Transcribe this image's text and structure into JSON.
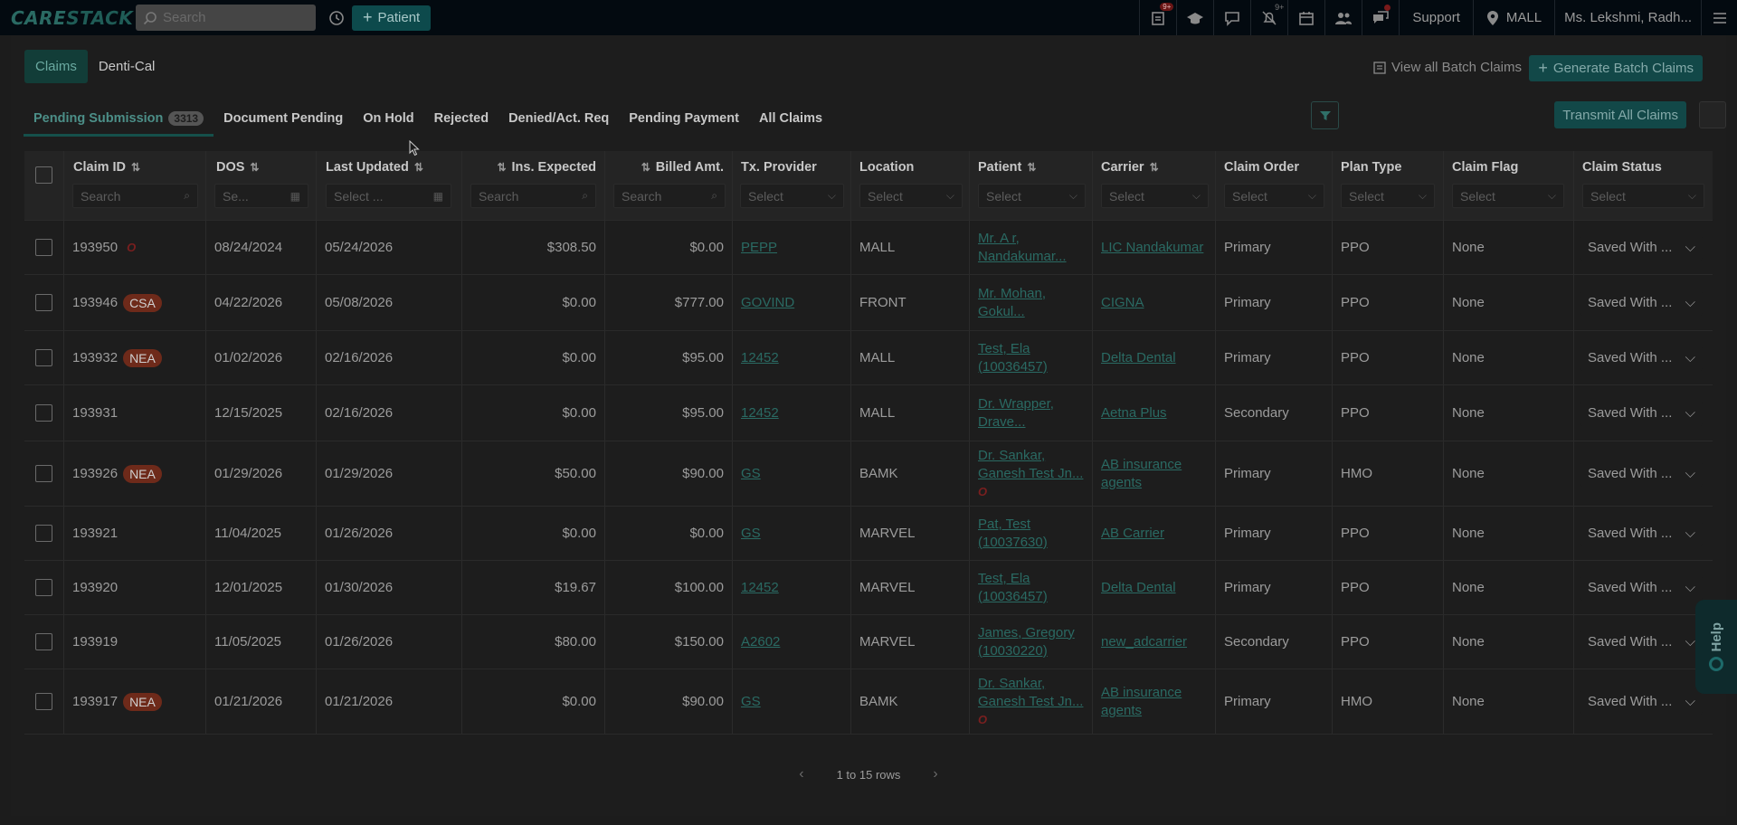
{
  "app": {
    "logo": "CARESTACK",
    "logo_a": "CARE",
    "logo_b": "STACK"
  },
  "topbar": {
    "search_placeholder": "Search",
    "add_patient_label": "Patient",
    "badge_tasks": "9+",
    "badge_notify": "9+",
    "support_label": "Support",
    "location_label": "MALL",
    "user_label": "Ms. Lekshmi, Radh..."
  },
  "subtabs": [
    {
      "label": "Claims",
      "active": true
    },
    {
      "label": "Denti-Cal",
      "active": false
    }
  ],
  "actions": {
    "view_batch_label": "View all Batch Claims",
    "generate_batch_label": "Generate Batch Claims",
    "transmit_label": "Transmit All Claims"
  },
  "tabs": [
    {
      "label": "Pending Submission",
      "count": "3313",
      "active": true
    },
    {
      "label": "Document Pending"
    },
    {
      "label": "On Hold"
    },
    {
      "label": "Rejected"
    },
    {
      "label": "Denied/Act. Req"
    },
    {
      "label": "Pending Payment"
    },
    {
      "label": "All Claims"
    }
  ],
  "columns": {
    "claim_id": {
      "label": "Claim ID",
      "placeholder": "Search"
    },
    "dos": {
      "label": "DOS",
      "placeholder": "Se..."
    },
    "last_updated": {
      "label": "Last Updated",
      "placeholder": "Select ..."
    },
    "ins_expected": {
      "label": "Ins. Expected",
      "placeholder": "Search"
    },
    "billed_amt": {
      "label": "Billed Amt.",
      "placeholder": "Search"
    },
    "tx_provider": {
      "label": "Tx. Provider",
      "placeholder": "Select"
    },
    "location": {
      "label": "Location",
      "placeholder": "Select"
    },
    "patient": {
      "label": "Patient",
      "placeholder": "Select"
    },
    "carrier": {
      "label": "Carrier",
      "placeholder": "Select"
    },
    "claim_order": {
      "label": "Claim Order",
      "placeholder": "Select"
    },
    "plan_type": {
      "label": "Plan Type",
      "placeholder": "Select"
    },
    "claim_flag": {
      "label": "Claim Flag",
      "placeholder": "Select"
    },
    "claim_status": {
      "label": "Claim Status",
      "placeholder": "Select"
    }
  },
  "rows": [
    {
      "id": "193950",
      "tag": "",
      "o": true,
      "dos": "08/24/2024",
      "updated": "05/24/2026",
      "ins": "$308.50",
      "billed": "$0.00",
      "provider": "PEPP",
      "location": "MALL",
      "patient1": "Mr. A r,",
      "patient2": "Nandakumar...",
      "patient_o": false,
      "carrier1": "LIC Nandakumar",
      "carrier2": "",
      "order": "Primary",
      "plan": "PPO",
      "flag": "None",
      "status": "Saved With ..."
    },
    {
      "id": "193946",
      "tag": "CSA",
      "o": false,
      "dos": "04/22/2026",
      "updated": "05/08/2026",
      "ins": "$0.00",
      "billed": "$777.00",
      "provider": "GOVIND",
      "location": "FRONT",
      "patient1": "Mr. Mohan,",
      "patient2": "Gokul...",
      "patient_o": false,
      "carrier1": "CIGNA",
      "carrier2": "",
      "order": "Primary",
      "plan": "PPO",
      "flag": "None",
      "status": "Saved With ..."
    },
    {
      "id": "193932",
      "tag": "NEA",
      "o": false,
      "dos": "01/02/2026",
      "updated": "02/16/2026",
      "ins": "$0.00",
      "billed": "$95.00",
      "provider": "12452",
      "location": "MALL",
      "patient1": "Test, Ela",
      "patient2": "(10036457)",
      "patient_o": false,
      "carrier1": "Delta Dental",
      "carrier2": "",
      "order": "Primary",
      "plan": "PPO",
      "flag": "None",
      "status": "Saved With ..."
    },
    {
      "id": "193931",
      "tag": "",
      "o": false,
      "dos": "12/15/2025",
      "updated": "02/16/2026",
      "ins": "$0.00",
      "billed": "$95.00",
      "provider": "12452",
      "location": "MALL",
      "patient1": "Dr. Wrapper,",
      "patient2": "Drave...",
      "patient_o": false,
      "carrier1": "Aetna Plus",
      "carrier2": "",
      "order": "Secondary",
      "plan": "PPO",
      "flag": "None",
      "status": "Saved With ..."
    },
    {
      "id": "193926",
      "tag": "NEA",
      "o": false,
      "dos": "01/29/2026",
      "updated": "01/29/2026",
      "ins": "$50.00",
      "billed": "$90.00",
      "provider": "GS",
      "location": "BAMK",
      "patient1": "Dr. Sankar,",
      "patient2": "Ganesh Test Jn...",
      "patient_o": true,
      "carrier1": "AB insurance",
      "carrier2": "agents",
      "order": "Primary",
      "plan": "HMO",
      "flag": "None",
      "status": "Saved With ..."
    },
    {
      "id": "193921",
      "tag": "",
      "o": false,
      "dos": "11/04/2025",
      "updated": "01/26/2026",
      "ins": "$0.00",
      "billed": "$0.00",
      "provider": "GS",
      "location": "MARVEL",
      "patient1": "Pat, Test",
      "patient2": "(10037630)",
      "patient_o": false,
      "carrier1": "AB Carrier",
      "carrier2": "",
      "order": "Primary",
      "plan": "PPO",
      "flag": "None",
      "status": "Saved With ..."
    },
    {
      "id": "193920",
      "tag": "",
      "o": false,
      "dos": "12/01/2025",
      "updated": "01/30/2026",
      "ins": "$19.67",
      "billed": "$100.00",
      "provider": "12452",
      "location": "MARVEL",
      "patient1": "Test, Ela",
      "patient2": "(10036457)",
      "patient_o": false,
      "carrier1": "Delta Dental",
      "carrier2": "",
      "order": "Primary",
      "plan": "PPO",
      "flag": "None",
      "status": "Saved With ..."
    },
    {
      "id": "193919",
      "tag": "",
      "o": false,
      "dos": "11/05/2025",
      "updated": "01/26/2026",
      "ins": "$80.00",
      "billed": "$150.00",
      "provider": "A2602",
      "location": "MARVEL",
      "patient1": "James, Gregory",
      "patient2": "(10030220)",
      "patient_o": false,
      "carrier1": "new_adcarrier",
      "carrier2": "",
      "order": "Secondary",
      "plan": "PPO",
      "flag": "None",
      "status": "Saved With ..."
    },
    {
      "id": "193917",
      "tag": "NEA",
      "o": false,
      "dos": "01/21/2026",
      "updated": "01/21/2026",
      "ins": "$0.00",
      "billed": "$90.00",
      "provider": "GS",
      "location": "BAMK",
      "patient1": "Dr. Sankar,",
      "patient2": "Ganesh Test Jn...",
      "patient_o": true,
      "carrier1": "AB insurance",
      "carrier2": "agents",
      "order": "Primary",
      "plan": "HMO",
      "flag": "None",
      "status": "Saved With ..."
    }
  ],
  "o_marker": "O",
  "pager": {
    "label": "1 to 15 rows"
  },
  "help": {
    "label": "Help"
  },
  "colors": {
    "accent": "#2a6a63",
    "badge": "#6e2a1a",
    "topbar": "#030a10"
  }
}
